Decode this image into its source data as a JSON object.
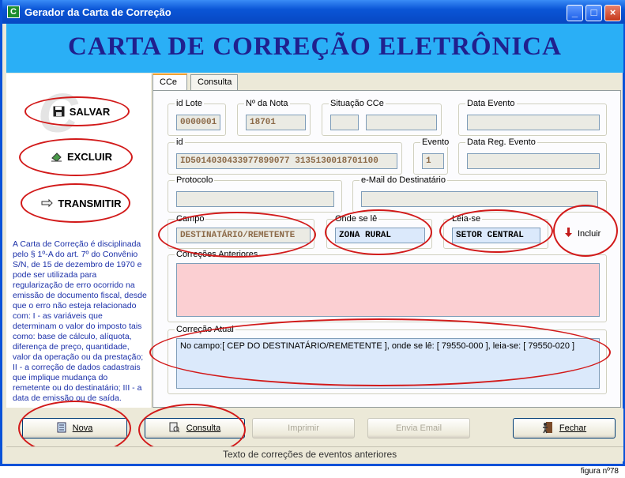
{
  "window": {
    "title": "Gerador da Carta de Correção",
    "app_icon": "C",
    "minimize": "_",
    "maximize": "□",
    "close": "×"
  },
  "banner": {
    "title": "CARTA DE CORREÇÃO ELETRÔNICA"
  },
  "left": {
    "salvar": "SALVAR",
    "excluir": "EXCLUIR",
    "transmitir": "TRANSMITIR",
    "legal_text": "A Carta de Correção é disciplinada pelo § 1º-A do art. 7º do Convênio S/N, de 15 de dezembro de 1970 e pode ser utilizada para regularização de erro ocorrido na emissão de documento fiscal, desde que o erro não esteja relacionado com: I - as variáveis que determinam o valor do imposto tais como: base de cálculo, alíquota, diferença de preço, quantidade, valor da operação ou da prestação; II - a correção de dados cadastrais que implique mudança do remetente ou do destinatário; III - a data de emissão ou de saída."
  },
  "tabs": [
    {
      "label": "CCe"
    },
    {
      "label": "Consulta"
    }
  ],
  "form": {
    "id_lote": {
      "label": "id Lote",
      "value": "0000001"
    },
    "nota": {
      "label": "Nº da Nota",
      "value": "18701"
    },
    "situacao": {
      "label": "Situação CCe",
      "value": ""
    },
    "data_evento": {
      "label": "Data Evento",
      "value": ""
    },
    "id": {
      "label": "id",
      "value": "ID5014030433977899077 3135130018701100"
    },
    "evento": {
      "label": "Evento",
      "value": "1"
    },
    "data_reg": {
      "label": "Data Reg. Evento",
      "value": ""
    },
    "protocolo": {
      "label": "Protocolo",
      "value": ""
    },
    "email": {
      "label": "e-Mail do Destinatário",
      "value": ""
    },
    "campo": {
      "label": "Campo",
      "value": "DESTINATÁRIO/REMETENTE"
    },
    "onde": {
      "label": "Onde se lê",
      "value": "ZONA RURAL"
    },
    "leia": {
      "label": "Leia-se",
      "value": "SETOR CENTRAL"
    },
    "incluir": "Incluir",
    "anteriores": {
      "label": "Correções Anteriores",
      "value": ""
    },
    "atual": {
      "label": "Correção Atual",
      "value": "No campo:[ CEP DO DESTINATÁRIO/REMETENTE ], onde se lê: [ 79550-000 ], leia-se: [ 79550-020 ]"
    }
  },
  "bottom": {
    "nova": "Nova",
    "consulta": "Consulta",
    "imprimir": "Imprimir",
    "envia_email": "Envia Email",
    "fechar": "Fechar"
  },
  "status": "Texto de correções de eventos anteriores",
  "figure_label": "figura nº78",
  "colors": {
    "banner": "#2aaff6",
    "banner_text": "#20208e",
    "annotation": "#d21a1a",
    "pink_field": "#fbcfd2",
    "blue_field": "#dbe9fb"
  }
}
